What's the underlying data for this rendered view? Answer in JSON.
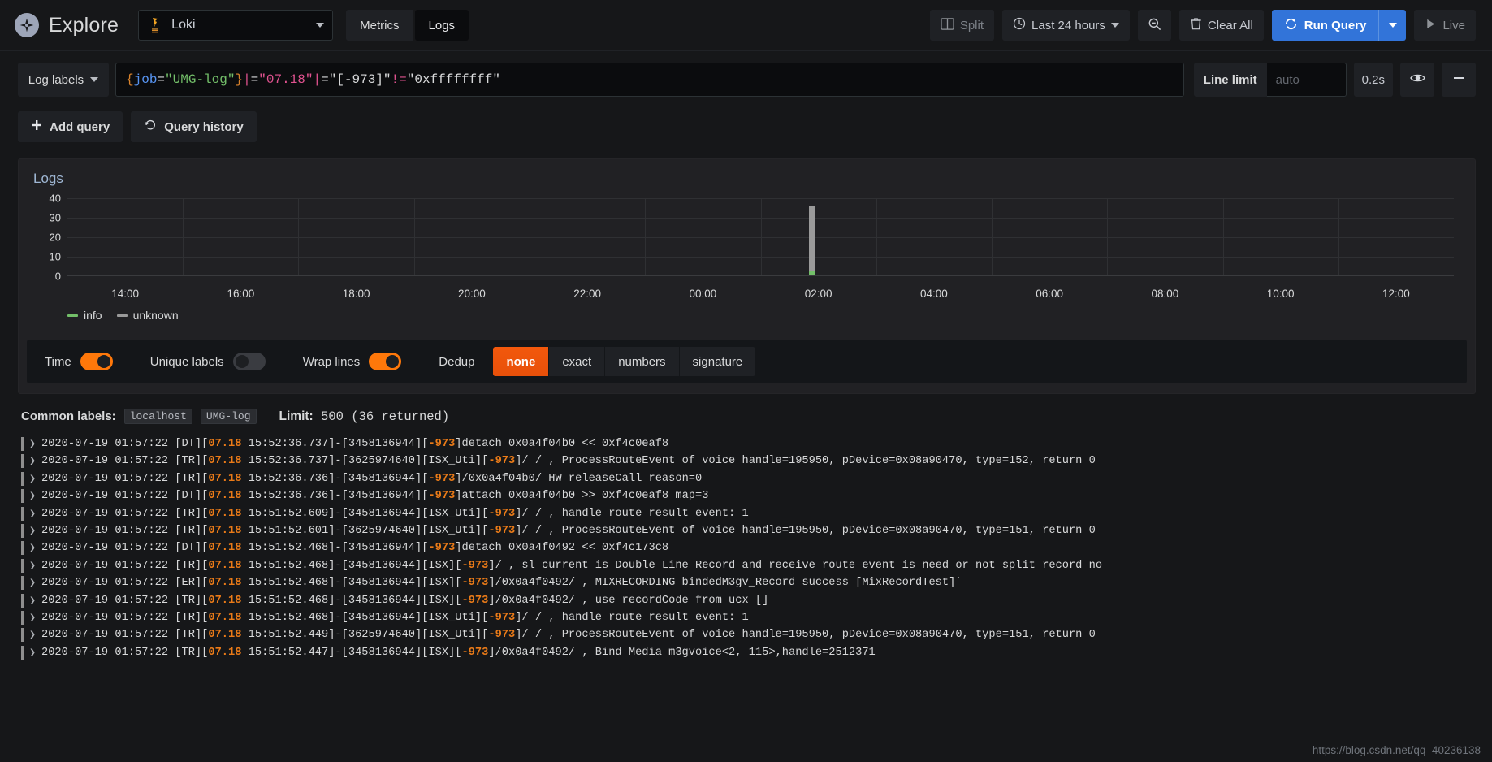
{
  "topnav": {
    "logo_icon": "grafana-explore-compass-icon",
    "title": "Explore",
    "datasource": {
      "icon": "loki-logo-icon",
      "name": "Loki",
      "caret_icon": "chevron-down-icon"
    },
    "modes": [
      {
        "label": "Metrics",
        "active": false,
        "name": "metrics"
      },
      {
        "label": "Logs",
        "active": true,
        "name": "logs"
      }
    ],
    "split_label": "Split",
    "split_icon": "split-panes-icon",
    "timerange_label": "Last 24 hours",
    "timerange_icon": "clock-icon",
    "timerange_caret": "chevron-down-icon",
    "zoomout_icon": "zoom-out-magnifier-icon",
    "clearall_label": "Clear All",
    "clearall_icon": "trash-icon",
    "run_label": "Run Query",
    "run_icon": "refresh-sync-icon",
    "run_caret_icon": "chevron-down-icon",
    "live_label": "Live",
    "live_icon": "play-triangle-icon"
  },
  "query": {
    "log_labels_label": "Log labels",
    "log_labels_caret": "chevron-down-icon",
    "expression_tokens": [
      {
        "text": "{",
        "cls": "t-brace"
      },
      {
        "text": "job",
        "cls": "t-key"
      },
      {
        "text": "=",
        "cls": "t-eq"
      },
      {
        "text": "\"UMG-log\"",
        "cls": "t-str"
      },
      {
        "text": "}",
        "cls": "t-brace"
      },
      {
        "text": " ",
        "cls": "t-plain"
      },
      {
        "text": "|",
        "cls": "t-pipe"
      },
      {
        "text": "= ",
        "cls": "t-op"
      },
      {
        "text": "\"07.18\"",
        "cls": "t-hl"
      },
      {
        "text": " ",
        "cls": "t-plain"
      },
      {
        "text": "|",
        "cls": "t-pipe"
      },
      {
        "text": "= ",
        "cls": "t-op"
      },
      {
        "text": "\"[-973]\"",
        "cls": "t-plain"
      },
      {
        "text": " ",
        "cls": "t-plain"
      },
      {
        "text": "!=",
        "cls": "t-pipe"
      },
      {
        "text": " ",
        "cls": "t-plain"
      },
      {
        "text": "\"0xffffffff\"",
        "cls": "t-plain"
      }
    ],
    "expression_raw": "{job=\"UMG-log\"} |= \"07.18\" |= \"[-973]\" != \"0xffffffff\"",
    "line_limit_label": "Line limit",
    "line_limit_value": "",
    "line_limit_placeholder": "auto",
    "duration": "0.2s",
    "eye_icon": "eye-visibility-icon",
    "remove_icon": "minus-remove-icon",
    "add_query_label": "Add query",
    "add_query_icon": "plus-icon",
    "query_history_label": "Query history",
    "query_history_icon": "history-undo-icon"
  },
  "panel": {
    "title": "Logs"
  },
  "chart_data": {
    "type": "bar",
    "title": "Logs",
    "xlabel": "",
    "ylabel": "",
    "ylim": [
      0,
      40
    ],
    "yticks": [
      0,
      10,
      20,
      30,
      40
    ],
    "grid": true,
    "legend_position": "bottom-left",
    "xtick_labels": [
      "14:00",
      "16:00",
      "18:00",
      "20:00",
      "22:00",
      "00:00",
      "02:00",
      "04:00",
      "06:00",
      "08:00",
      "10:00",
      "12:00"
    ],
    "series": [
      {
        "name": "info",
        "color": "#73bf69",
        "values_at_bar": 2
      },
      {
        "name": "unknown",
        "color": "#9a9a9a",
        "values_at_bar": 34
      }
    ],
    "bars": [
      {
        "x": "01:57",
        "info": 2,
        "unknown": 34,
        "total": 36
      }
    ]
  },
  "controls": {
    "time_label": "Time",
    "time_on": true,
    "unique_labels_label": "Unique labels",
    "unique_labels_on": false,
    "wrap_lines_label": "Wrap lines",
    "wrap_lines_on": true,
    "dedup_label": "Dedup",
    "dedup_options": [
      {
        "label": "none",
        "active": true
      },
      {
        "label": "exact",
        "active": false
      },
      {
        "label": "numbers",
        "active": false
      },
      {
        "label": "signature",
        "active": false
      }
    ]
  },
  "meta": {
    "common_labels_label": "Common labels:",
    "common_labels": [
      "localhost",
      "UMG-log"
    ],
    "limit_label": "Limit:",
    "limit_value": "500",
    "returned_text": "(36 returned)"
  },
  "log_rows": [
    {
      "level": "unknown",
      "chevron": "❯",
      "parts": [
        {
          "t": "2020-07-19 01:57:22 [DT][",
          "c": ""
        },
        {
          "t": "07.18",
          "c": "hl"
        },
        {
          "t": " 15:52:36.737]-[3458136944][",
          "c": ""
        },
        {
          "t": "-973",
          "c": "hl"
        },
        {
          "t": "]detach 0x0a4f04b0 << 0xf4c0eaf8",
          "c": ""
        }
      ]
    },
    {
      "level": "unknown",
      "chevron": "❯",
      "parts": [
        {
          "t": "2020-07-19 01:57:22 [TR][",
          "c": ""
        },
        {
          "t": "07.18",
          "c": "hl"
        },
        {
          "t": " 15:52:36.737]-[3625974640][ISX_Uti][",
          "c": ""
        },
        {
          "t": "-973",
          "c": "hl"
        },
        {
          "t": "]/ / , ProcessRouteEvent of voice handle=195950, pDevice=0x08a90470, type=152, return 0",
          "c": ""
        }
      ]
    },
    {
      "level": "unknown",
      "chevron": "❯",
      "parts": [
        {
          "t": "2020-07-19 01:57:22 [TR][",
          "c": ""
        },
        {
          "t": "07.18",
          "c": "hl"
        },
        {
          "t": " 15:52:36.736]-[3458136944][",
          "c": ""
        },
        {
          "t": "-973",
          "c": "hl"
        },
        {
          "t": "]/0x0a4f04b0/ HW releaseCall reason=0",
          "c": ""
        }
      ]
    },
    {
      "level": "unknown",
      "chevron": "❯",
      "parts": [
        {
          "t": "2020-07-19 01:57:22 [DT][",
          "c": ""
        },
        {
          "t": "07.18",
          "c": "hl"
        },
        {
          "t": " 15:52:36.736]-[3458136944][",
          "c": ""
        },
        {
          "t": "-973",
          "c": "hl"
        },
        {
          "t": "]attach 0x0a4f04b0 >> 0xf4c0eaf8 map=3",
          "c": ""
        }
      ]
    },
    {
      "level": "unknown",
      "chevron": "❯",
      "parts": [
        {
          "t": "2020-07-19 01:57:22 [TR][",
          "c": ""
        },
        {
          "t": "07.18",
          "c": "hl"
        },
        {
          "t": " 15:51:52.609]-[3458136944][ISX_Uti][",
          "c": ""
        },
        {
          "t": "-973",
          "c": "hl"
        },
        {
          "t": "]/ / , handle route result event: 1",
          "c": ""
        }
      ]
    },
    {
      "level": "unknown",
      "chevron": "❯",
      "parts": [
        {
          "t": "2020-07-19 01:57:22 [TR][",
          "c": ""
        },
        {
          "t": "07.18",
          "c": "hl"
        },
        {
          "t": " 15:51:52.601]-[3625974640][ISX_Uti][",
          "c": ""
        },
        {
          "t": "-973",
          "c": "hl"
        },
        {
          "t": "]/ / , ProcessRouteEvent of voice handle=195950, pDevice=0x08a90470, type=151, return 0",
          "c": ""
        }
      ]
    },
    {
      "level": "unknown",
      "chevron": "❯",
      "parts": [
        {
          "t": "2020-07-19 01:57:22 [DT][",
          "c": ""
        },
        {
          "t": "07.18",
          "c": "hl"
        },
        {
          "t": " 15:51:52.468]-[3458136944][",
          "c": ""
        },
        {
          "t": "-973",
          "c": "hl"
        },
        {
          "t": "]detach 0x0a4f0492 << 0xf4c173c8",
          "c": ""
        }
      ]
    },
    {
      "level": "unknown",
      "chevron": "❯",
      "parts": [
        {
          "t": "2020-07-19 01:57:22 [TR][",
          "c": ""
        },
        {
          "t": "07.18",
          "c": "hl"
        },
        {
          "t": " 15:51:52.468]-[3458136944][ISX][",
          "c": ""
        },
        {
          "t": "-973",
          "c": "hl"
        },
        {
          "t": "]/ , sl current is Double Line Record and receive route event is need or not split record  no",
          "c": ""
        }
      ]
    },
    {
      "level": "unknown",
      "chevron": "❯",
      "parts": [
        {
          "t": "2020-07-19 01:57:22 [ER][",
          "c": ""
        },
        {
          "t": "07.18",
          "c": "hl"
        },
        {
          "t": " 15:51:52.468]-[3458136944][ISX][",
          "c": ""
        },
        {
          "t": "-973",
          "c": "hl"
        },
        {
          "t": "]/0x0a4f0492/ ,  MIXRECORDING bindedM3gv_Record success  [MixRecordTest]`",
          "c": ""
        }
      ]
    },
    {
      "level": "unknown",
      "chevron": "❯",
      "parts": [
        {
          "t": "2020-07-19 01:57:22 [TR][",
          "c": ""
        },
        {
          "t": "07.18",
          "c": "hl"
        },
        {
          "t": " 15:51:52.468]-[3458136944][ISX][",
          "c": ""
        },
        {
          "t": "-973",
          "c": "hl"
        },
        {
          "t": "]/0x0a4f0492/ , use recordCode from ucx []",
          "c": ""
        }
      ]
    },
    {
      "level": "unknown",
      "chevron": "❯",
      "parts": [
        {
          "t": "2020-07-19 01:57:22 [TR][",
          "c": ""
        },
        {
          "t": "07.18",
          "c": "hl"
        },
        {
          "t": " 15:51:52.468]-[3458136944][ISX_Uti][",
          "c": ""
        },
        {
          "t": "-973",
          "c": "hl"
        },
        {
          "t": "]/ / , handle route result event: 1",
          "c": ""
        }
      ]
    },
    {
      "level": "unknown",
      "chevron": "❯",
      "parts": [
        {
          "t": "2020-07-19 01:57:22 [TR][",
          "c": ""
        },
        {
          "t": "07.18",
          "c": "hl"
        },
        {
          "t": " 15:51:52.449]-[3625974640][ISX_Uti][",
          "c": ""
        },
        {
          "t": "-973",
          "c": "hl"
        },
        {
          "t": "]/ / , ProcessRouteEvent of voice handle=195950, pDevice=0x08a90470, type=151, return 0",
          "c": ""
        }
      ]
    },
    {
      "level": "unknown",
      "chevron": "❯",
      "parts": [
        {
          "t": "2020-07-19 01:57:22 [TR][",
          "c": ""
        },
        {
          "t": "07.18",
          "c": "hl"
        },
        {
          "t": " 15:51:52.447]-[3458136944][ISX][",
          "c": ""
        },
        {
          "t": "-973",
          "c": "hl"
        },
        {
          "t": "]/0x0a4f0492/ , Bind Media m3gvoice<2, 115>,handle=2512371",
          "c": ""
        }
      ]
    }
  ],
  "watermark": "https://blog.csdn.net/qq_40236138",
  "colors": {
    "accent_blue": "#3274d9",
    "accent_orange": "#ff780a",
    "info_green": "#73bf69",
    "unknown_gray": "#9a9a9a",
    "panel_bg": "#212124",
    "page_bg": "#161719"
  }
}
